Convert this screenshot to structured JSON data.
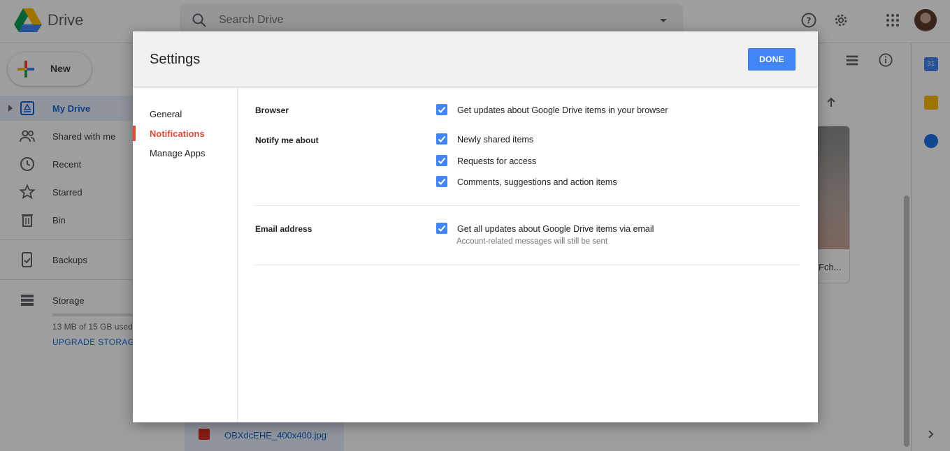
{
  "app": {
    "name": "Drive",
    "search_placeholder": "Search Drive"
  },
  "sidebar": {
    "new_label": "New",
    "items": [
      {
        "label": "My Drive"
      },
      {
        "label": "Shared with me"
      },
      {
        "label": "Recent"
      },
      {
        "label": "Starred"
      },
      {
        "label": "Bin"
      },
      {
        "label": "Backups"
      },
      {
        "label": "Storage"
      }
    ],
    "storage_usage": "13 MB of 15 GB used",
    "upgrade_label": "UPGRADE STORAGE"
  },
  "background_files": {
    "thumb_name": "Fch...",
    "file_chip_name": "OBXdcEHE_400x400.jpg"
  },
  "right_panel": {
    "calendar_day": "31"
  },
  "dialog": {
    "title": "Settings",
    "done_label": "DONE",
    "menu": [
      {
        "label": "General"
      },
      {
        "label": "Notifications"
      },
      {
        "label": "Manage Apps"
      }
    ],
    "sections": {
      "browser": {
        "label": "Browser",
        "option": "Get updates about Google Drive items in your browser"
      },
      "notify": {
        "label": "Notify me about",
        "options": [
          "Newly shared items",
          "Requests for access",
          "Comments, suggestions and action items"
        ]
      },
      "email": {
        "label": "Email address",
        "option": "Get all updates about Google Drive items via email",
        "note": "Account-related messages will still be sent"
      }
    }
  },
  "colors": {
    "accent": "#4285f4",
    "active_menu": "#dd4b39"
  }
}
